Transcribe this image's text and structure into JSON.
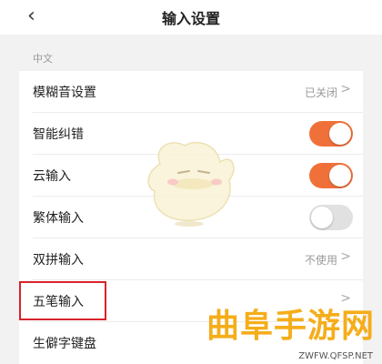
{
  "header": {
    "title": "输入设置",
    "back_icon": "chevron-left-icon"
  },
  "section": {
    "label": "中文"
  },
  "rows": [
    {
      "label": "模糊音设置",
      "value": "已关闭",
      "control": "chevron"
    },
    {
      "label": "智能纠错",
      "control": "toggle",
      "on": true
    },
    {
      "label": "云输入",
      "control": "toggle",
      "on": true
    },
    {
      "label": "繁体输入",
      "control": "toggle",
      "on": false
    },
    {
      "label": "双拼输入",
      "value": "不使用",
      "control": "chevron"
    },
    {
      "label": "五笔输入",
      "control": "chevron",
      "highlighted": true
    },
    {
      "label": "生僻字键盘",
      "control": "none"
    }
  ],
  "watermark": {
    "text": "曲阜手游网",
    "url": "ZWFW.QFSP.NET"
  },
  "colors": {
    "accent": "#f0703a",
    "highlight": "#d8232a",
    "watermark": "#f5ad1a"
  }
}
